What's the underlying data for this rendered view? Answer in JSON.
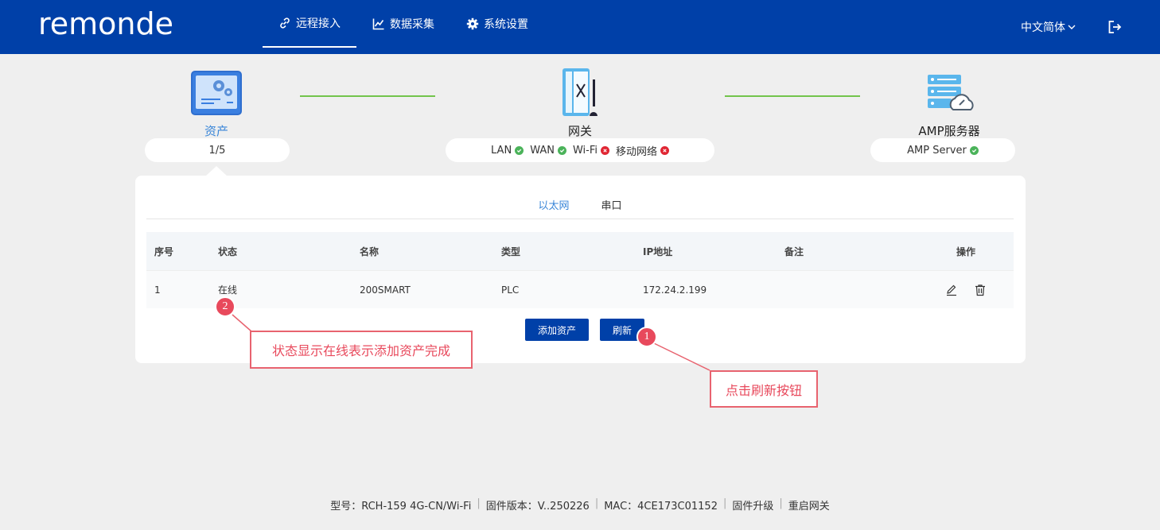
{
  "header": {
    "logo": "remonde",
    "nav": [
      {
        "label": "远程接入",
        "icon": "link-icon"
      },
      {
        "label": "数据采集",
        "icon": "chart-icon"
      },
      {
        "label": "系统设置",
        "icon": "gear-icon"
      }
    ],
    "language": "中文简体"
  },
  "topology": {
    "asset": {
      "label": "资产",
      "count": "1/5"
    },
    "gateway": {
      "label": "网关",
      "statuses": [
        {
          "name": "LAN",
          "state": "ok"
        },
        {
          "name": "WAN",
          "state": "ok"
        },
        {
          "name": "Wi-Fi",
          "state": "error"
        },
        {
          "name": "移动网络",
          "state": "error"
        }
      ]
    },
    "server": {
      "label": "AMP服务器",
      "status": {
        "name": "AMP Server",
        "state": "ok"
      }
    }
  },
  "tabs": [
    "以太网",
    "串口"
  ],
  "table": {
    "headers": [
      "序号",
      "状态",
      "名称",
      "类型",
      "IP地址",
      "备注",
      "操作"
    ],
    "rows": [
      {
        "index": "1",
        "status": "在线",
        "name": "200SMART",
        "type": "PLC",
        "ip": "172.24.2.199",
        "note": ""
      }
    ]
  },
  "buttons": {
    "add_asset": "添加资产",
    "refresh": "刷新"
  },
  "annotations": {
    "badge1": "1",
    "badge2": "2",
    "callout1": "点击刷新按钮",
    "callout2": "状态显示在线表示添加资产完成"
  },
  "footer": {
    "model": "型号：RCH-159  4G-CN/Wi-Fi",
    "firmware": "固件版本：V..250226",
    "mac": "MAC：4CE173C01152",
    "upgrade": "固件升级",
    "reboot": "重启网关"
  },
  "colors": {
    "brand": "#0040a8",
    "ok": "#4bb35a",
    "error": "#e02633",
    "annotation": "#e8495c",
    "link_line": "#72c44b"
  }
}
